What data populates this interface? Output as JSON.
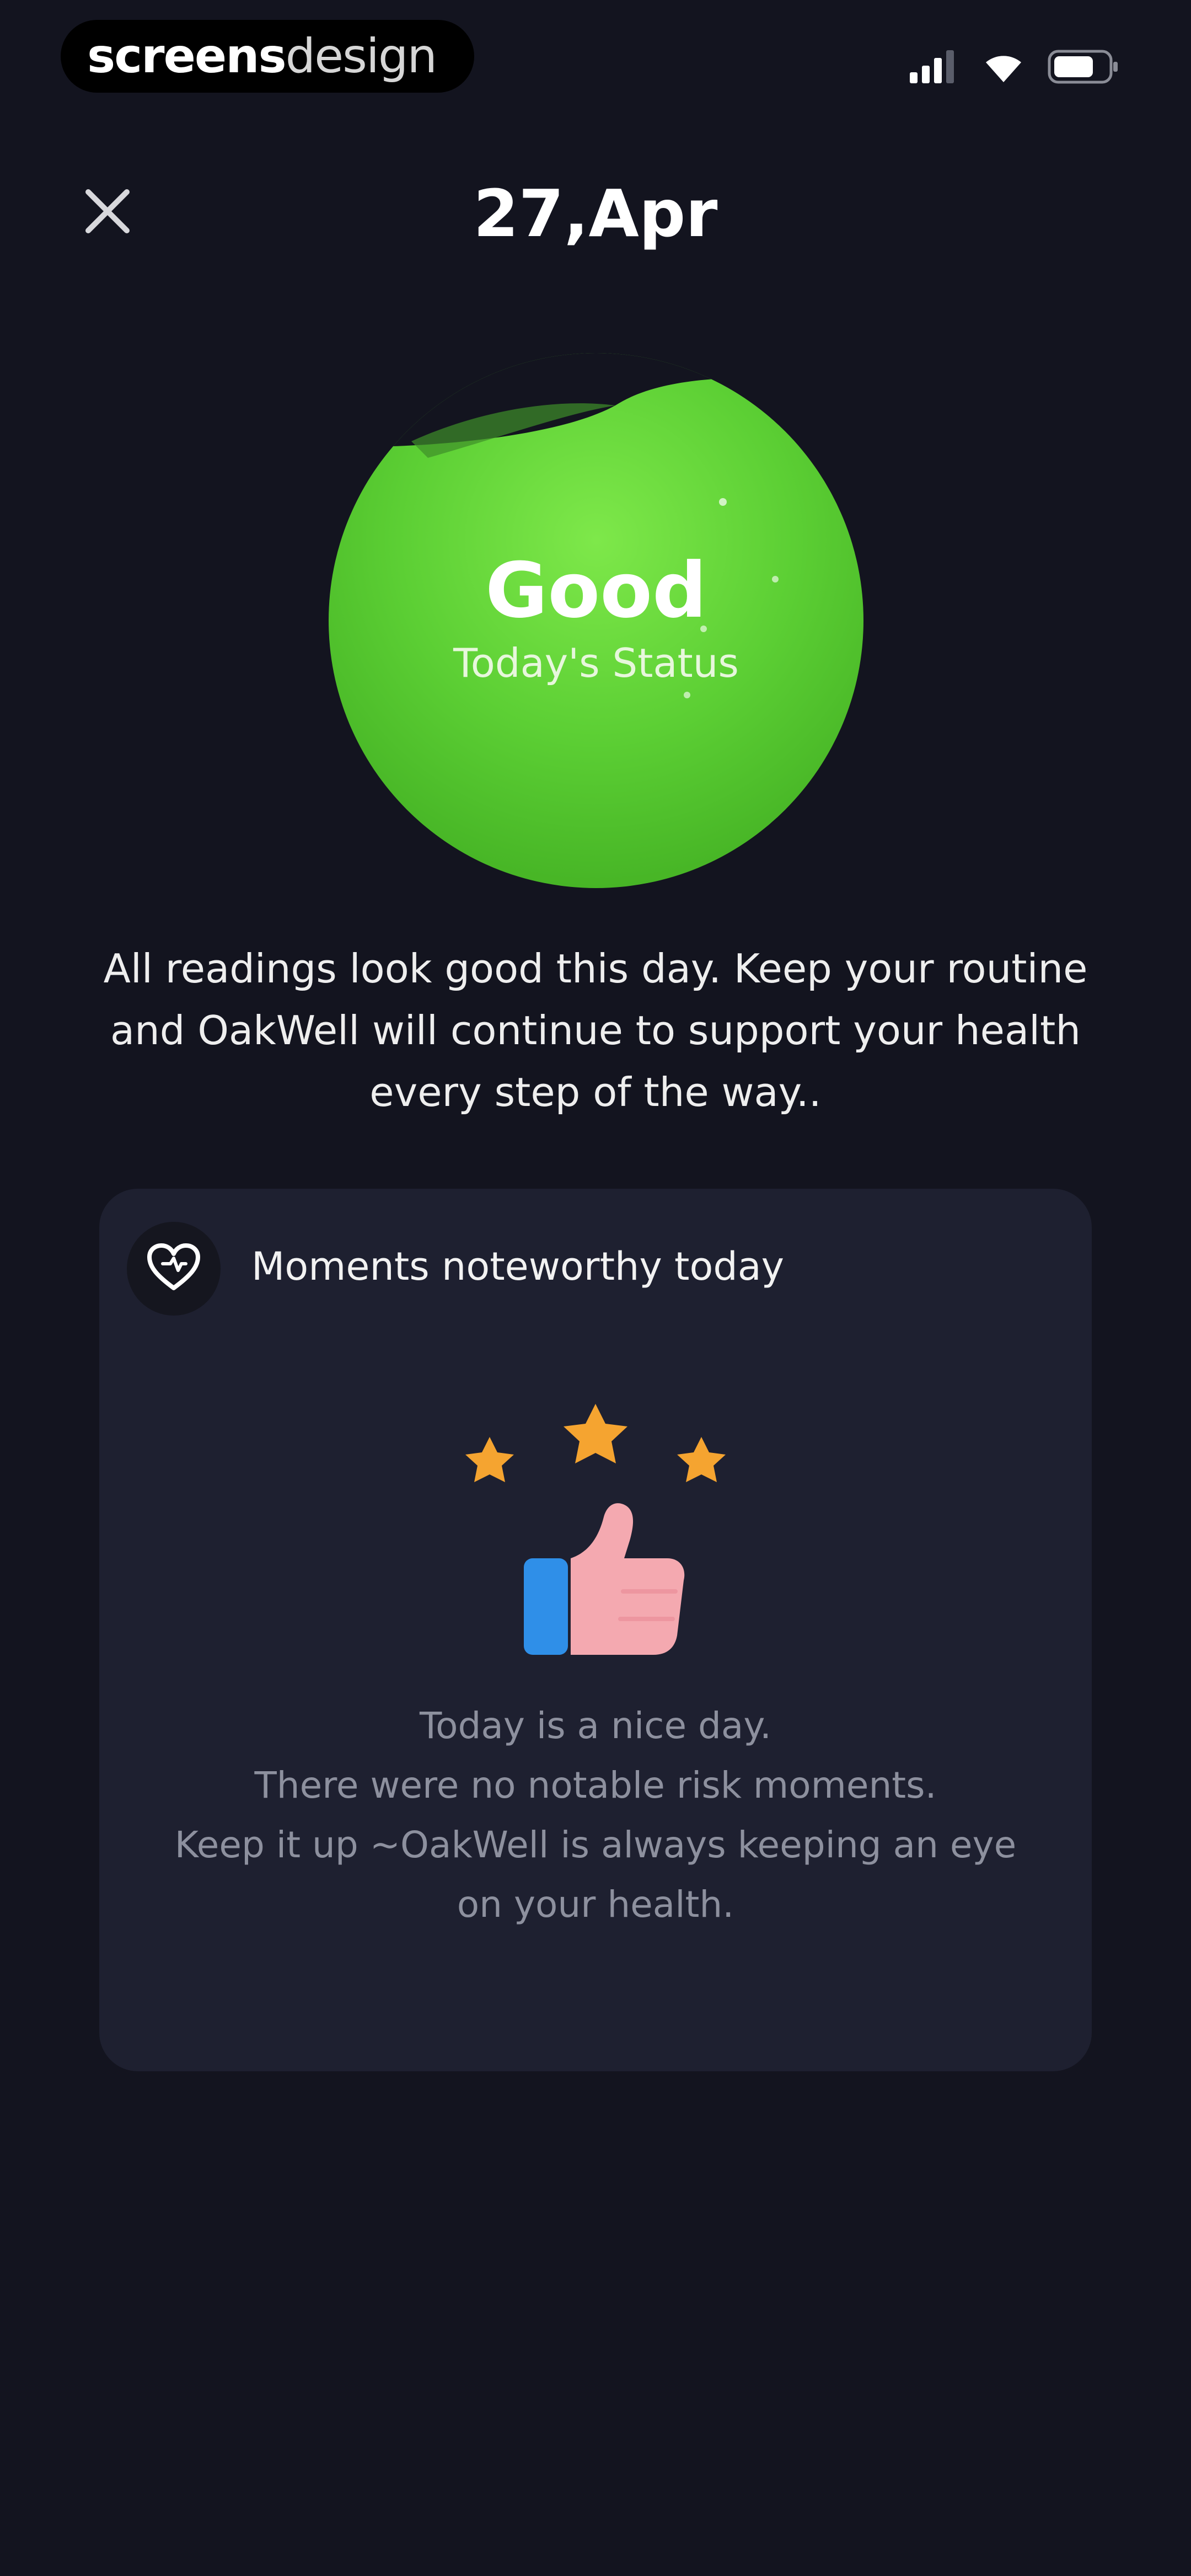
{
  "status_bar": {
    "watermark_bold": "screens",
    "watermark_thin": "design",
    "icons": [
      "signal-icon",
      "wifi-icon",
      "battery-icon"
    ]
  },
  "header": {
    "title": "27,Apr",
    "close_icon": "close-icon"
  },
  "status": {
    "level": "Good",
    "caption": "Today's Status",
    "color": "#5ccf34"
  },
  "description": "All readings look good this day. Keep your routine and OakWell will continue to support your health every step of the way..",
  "card": {
    "icon": "heart-icon",
    "title": "Moments noteworthy today",
    "illustration": "thumbs-up-stars-icon",
    "message_lines": [
      "Today is a nice day.",
      "There were no notable risk moments.",
      "Keep it up ~OakWell is always keeping an eye",
      "on your health."
    ]
  },
  "colors": {
    "background": "#13141f",
    "card": "#1e2030",
    "accent_green": "#5ccf34",
    "star": "#f5a430",
    "thumb": "#f4a9b0",
    "cuff": "#2f8fe8"
  }
}
